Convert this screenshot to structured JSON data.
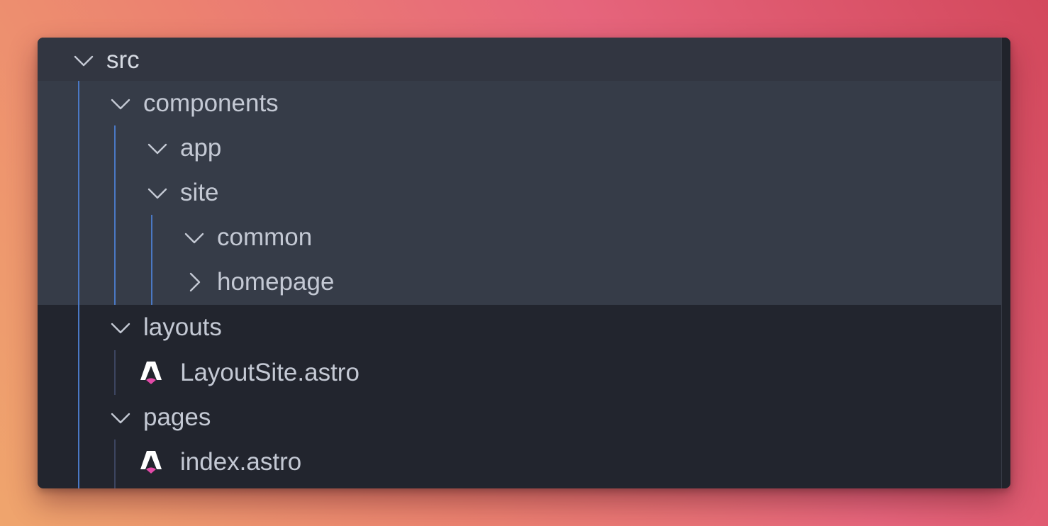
{
  "tree": {
    "root": {
      "label": "src",
      "expanded": true,
      "icon": "chevron-down-icon"
    },
    "components": {
      "label": "components",
      "expanded": true,
      "icon": "chevron-down-icon"
    },
    "app": {
      "label": "app",
      "expanded": true,
      "icon": "chevron-down-icon"
    },
    "site": {
      "label": "site",
      "expanded": true,
      "icon": "chevron-down-icon"
    },
    "common": {
      "label": "common",
      "expanded": true,
      "icon": "chevron-down-icon"
    },
    "homepage": {
      "label": "homepage",
      "expanded": false,
      "icon": "chevron-right-icon"
    },
    "layouts": {
      "label": "layouts",
      "expanded": true,
      "icon": "chevron-down-icon"
    },
    "layout_file": {
      "label": "LayoutSite.astro",
      "icon": "astro-file-icon"
    },
    "pages": {
      "label": "pages",
      "expanded": true,
      "icon": "chevron-down-icon"
    },
    "index_file": {
      "label": "index.astro",
      "icon": "astro-file-icon"
    }
  },
  "colors": {
    "panel_bg": "#22252e",
    "highlight_bg": "#363c48",
    "text": "#c4c9d4",
    "indent_guide": "#4a78c4",
    "astro_accent": "#e24aa8"
  }
}
